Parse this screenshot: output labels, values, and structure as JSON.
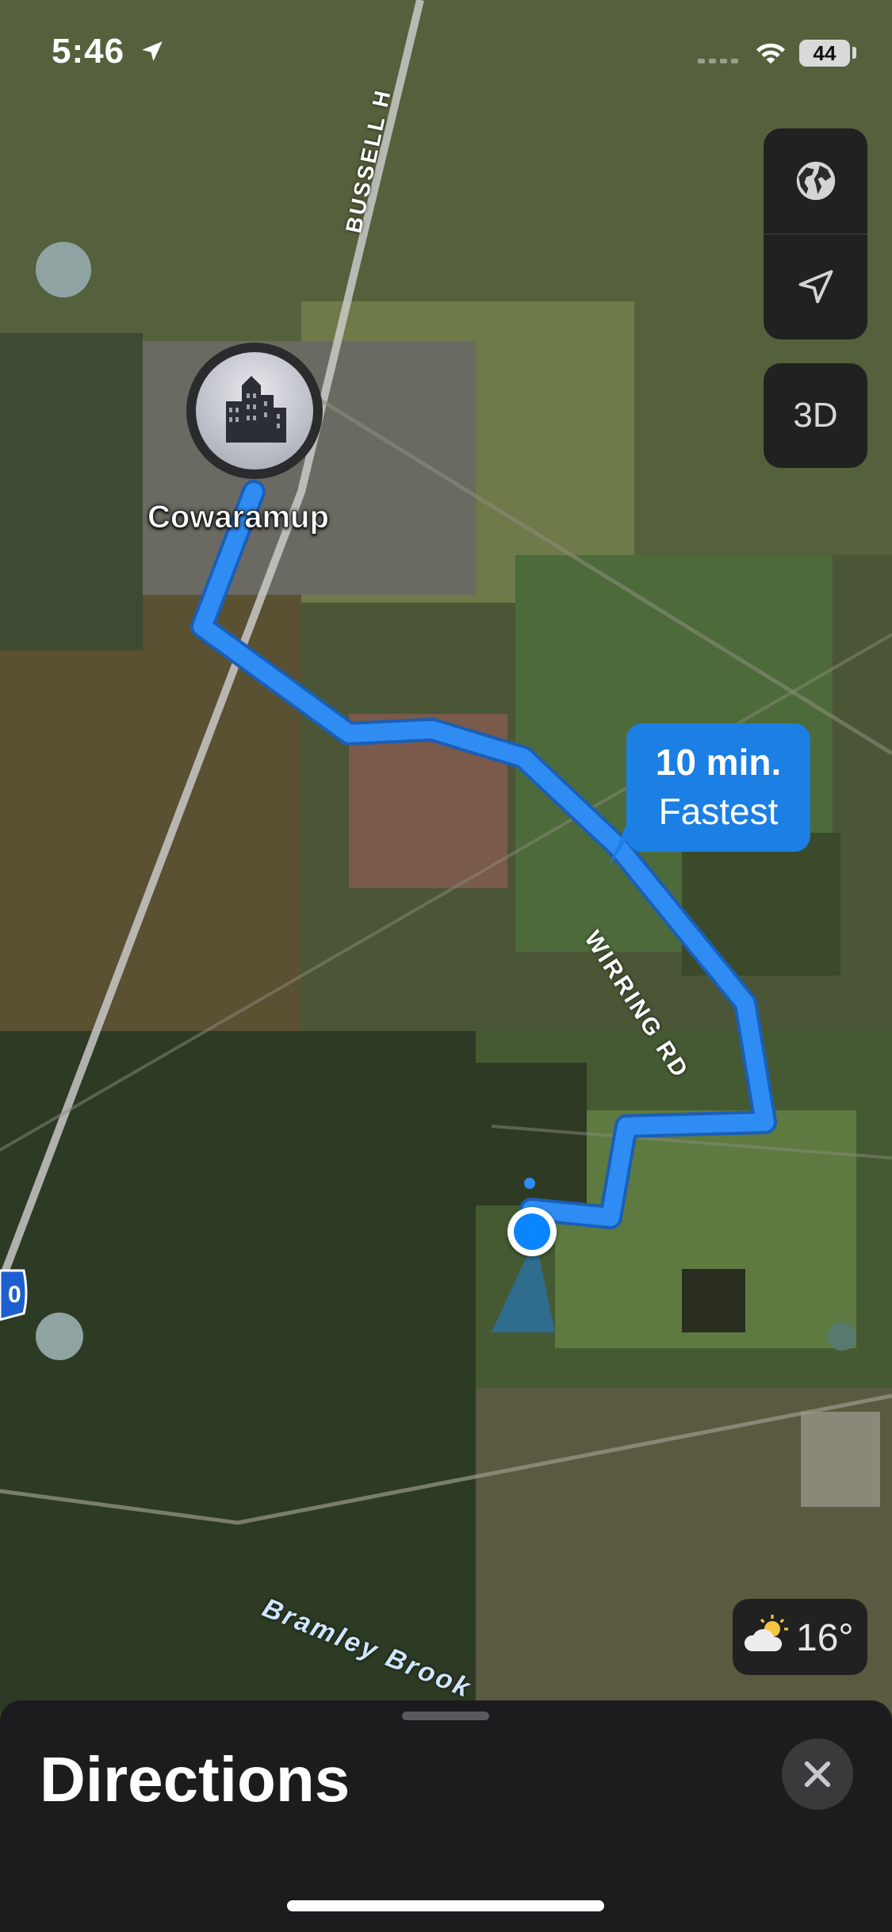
{
  "status_bar": {
    "time": "5:46",
    "battery": "44"
  },
  "map": {
    "place_name": "Cowaramup",
    "route": {
      "duration": "10 min.",
      "label": "Fastest"
    },
    "road_labels": {
      "wirring": "WIRRING RD",
      "bussell": "BUSSELL H"
    },
    "water_label": "Bramley Brook",
    "highway_shield": "0"
  },
  "controls": {
    "globe_icon": "globe-icon",
    "location_icon": "location-arrow-icon",
    "view_3d": "3D"
  },
  "weather": {
    "temperature": "16°",
    "icon": "partly-sunny-icon"
  },
  "sheet": {
    "title": "Directions",
    "close_icon": "close-icon"
  },
  "colors": {
    "route": "#2f8cf2",
    "callout": "#1b7fe4",
    "user_dot": "#0a84ff",
    "sheet": "#1c1c1e"
  }
}
